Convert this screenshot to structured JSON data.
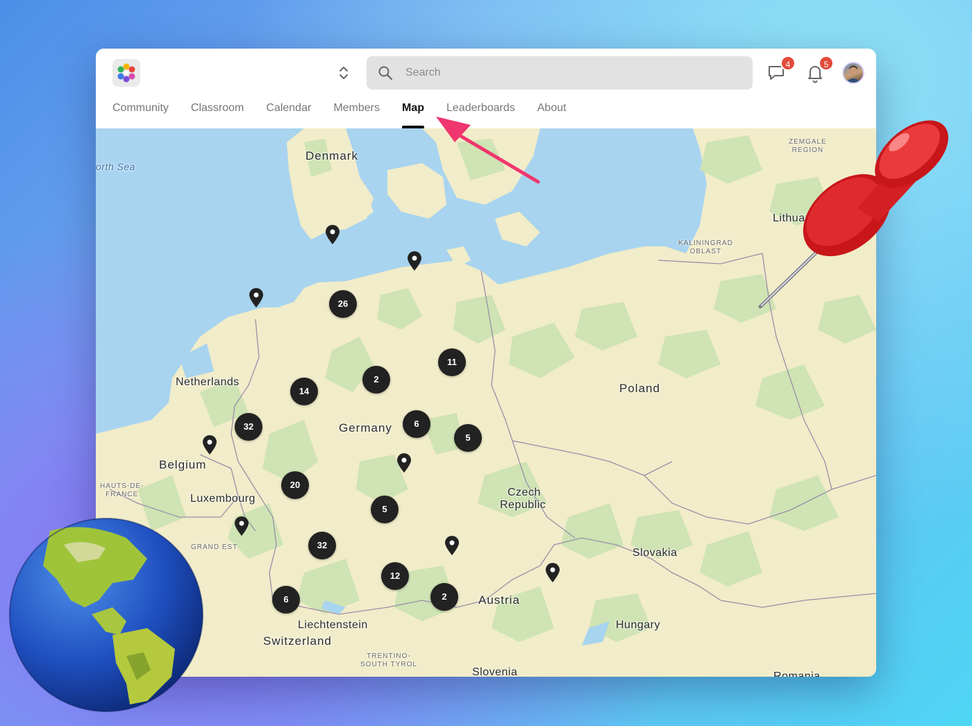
{
  "header": {
    "search_placeholder": "Search",
    "chat_badge": "4",
    "notif_badge": "5"
  },
  "tabs": [
    {
      "label": "Community"
    },
    {
      "label": "Classroom"
    },
    {
      "label": "Calendar"
    },
    {
      "label": "Members"
    },
    {
      "label": "Map",
      "active": true
    },
    {
      "label": "Leaderboards"
    },
    {
      "label": "About"
    }
  ],
  "map": {
    "places": {
      "denmark": "Denmark",
      "north_sea": "orth Sea",
      "netherlands": "Netherlands",
      "belgium": "Belgium",
      "luxembourg": "Luxembourg",
      "germany": "Germany",
      "poland": "Poland",
      "czech_1": "Czech",
      "czech_2": "Republic",
      "slovakia": "Slovakia",
      "austria": "Austria",
      "hungary": "Hungary",
      "liechtenstein": "Liechtenstein",
      "switzerland": "Switzerland",
      "slovenia": "Slovenia",
      "lithuania": "Lithuan",
      "romania": "Romania",
      "zemgale_1": "ZEMGALE",
      "zemgale_2": "REGION",
      "kaliningrad_1": "KALININGRAD",
      "kaliningrad_2": "OBLAST",
      "hauts_1": "HAUTS-DE-",
      "hauts_2": "FRANCE",
      "grand_est": "GRAND EST",
      "trentino_1": "TRENTINO-",
      "trentino_2": "SOUTH TYROL"
    },
    "clusters": [
      "26",
      "11",
      "2",
      "14",
      "32",
      "6",
      "5",
      "20",
      "5",
      "32",
      "12",
      "6",
      "2"
    ]
  },
  "colors": {
    "land": "#f1ecc9",
    "forest": "#cfe3b4",
    "water": "#a8d4ef",
    "marker": "#222222",
    "badge": "#e24b3b",
    "arrow": "#f0366e"
  }
}
